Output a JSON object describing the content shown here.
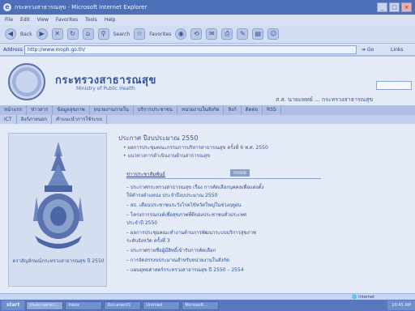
{
  "window": {
    "title": "กระทรวงสาธารณสุข - Microsoft Internet Explorer",
    "controls": [
      "_",
      "□",
      "×"
    ]
  },
  "menu": [
    "File",
    "Edit",
    "View",
    "Favorites",
    "Tools",
    "Help"
  ],
  "toolbar": {
    "back_label": "Back",
    "search_label": "Search",
    "favorites_label": "Favorites"
  },
  "address": {
    "label": "Address",
    "value": "http://www.moph.go.th/",
    "go_label": "Go",
    "links_label": "Links"
  },
  "site": {
    "title_thai": "กระทรวงสาธารณสุข",
    "title_eng": "Ministry of Public Health",
    "banner_name": "ส.ส. นายแพทย์ ... กระทรวงสาธารณสุข"
  },
  "nav": {
    "row1": [
      "หน้าแรก",
      "ข่าวสาร",
      "ข้อมูลสุขภาพ",
      "หน่วยงานภายใน",
      "บริการประชาชน",
      "หน่วยงานในสังกัด",
      "ลิงก์",
      "ติดต่อ",
      "RSS"
    ],
    "row2": [
      "ICT",
      "ลิงก์ภายนอก",
      "คำแนะนำการใช้ระบบ"
    ]
  },
  "emblem_caption": "ตราสัญลักษณ์กระทรวงสาธารณสุข ปี 2550",
  "content": {
    "title": "ประกาศ ปีงบประมาณ 2550",
    "bullets": [
      "ผลการประชุมคณะกรรมการบริหารสาธารณสุข ครั้งที่ 6 พ.ศ. 2550",
      "แนวทางการดำเนินงานด้านสาธารณสุข"
    ],
    "subhead": "ข่าวประชาสัมพันธ์",
    "subhead_btn": "more",
    "lines": [
      "– ประกาศกระทรวงสาธารณสุข เรื่อง การคัดเลือกบุคคลเพื่อแต่งตั้ง",
      "   ให้ดำรงตำแหน่ง ประจำปีงบประมาณ 2550",
      "– สธ. เตือนประชาชนระวังโรคไข้หวัดใหญ่ในช่วงฤดูฝน",
      "– โครงการรณรงค์เพื่อสุขภาพที่ดีของประชาชนทั่วประเทศ",
      "   ประจำปี 2550",
      "– ผลการประชุมคณะทำงานด้านการพัฒนาระบบบริการสุขภาพ",
      "   ระดับจังหวัด ครั้งที่ 3",
      "– ประกาศรายชื่อผู้มีสิทธิ์เข้ารับการคัดเลือก",
      "– การจัดสรรงบประมาณสำหรับหน่วยงานในสังกัด",
      "– แผนยุทธศาสตร์กระทรวงสาธารณสุข ปี 2550 – 2554"
    ]
  },
  "status": {
    "zone": "Internet"
  },
  "taskbar": {
    "start": "start",
    "tasks": [
      "กระทรวงสาธา...",
      "Inbox",
      "Document1",
      "Untitled",
      "Microsoft..."
    ],
    "tray": "10:45 AM"
  },
  "colors": {
    "accent": "#4d6fb8",
    "page_bg": "#e4ebf7"
  }
}
